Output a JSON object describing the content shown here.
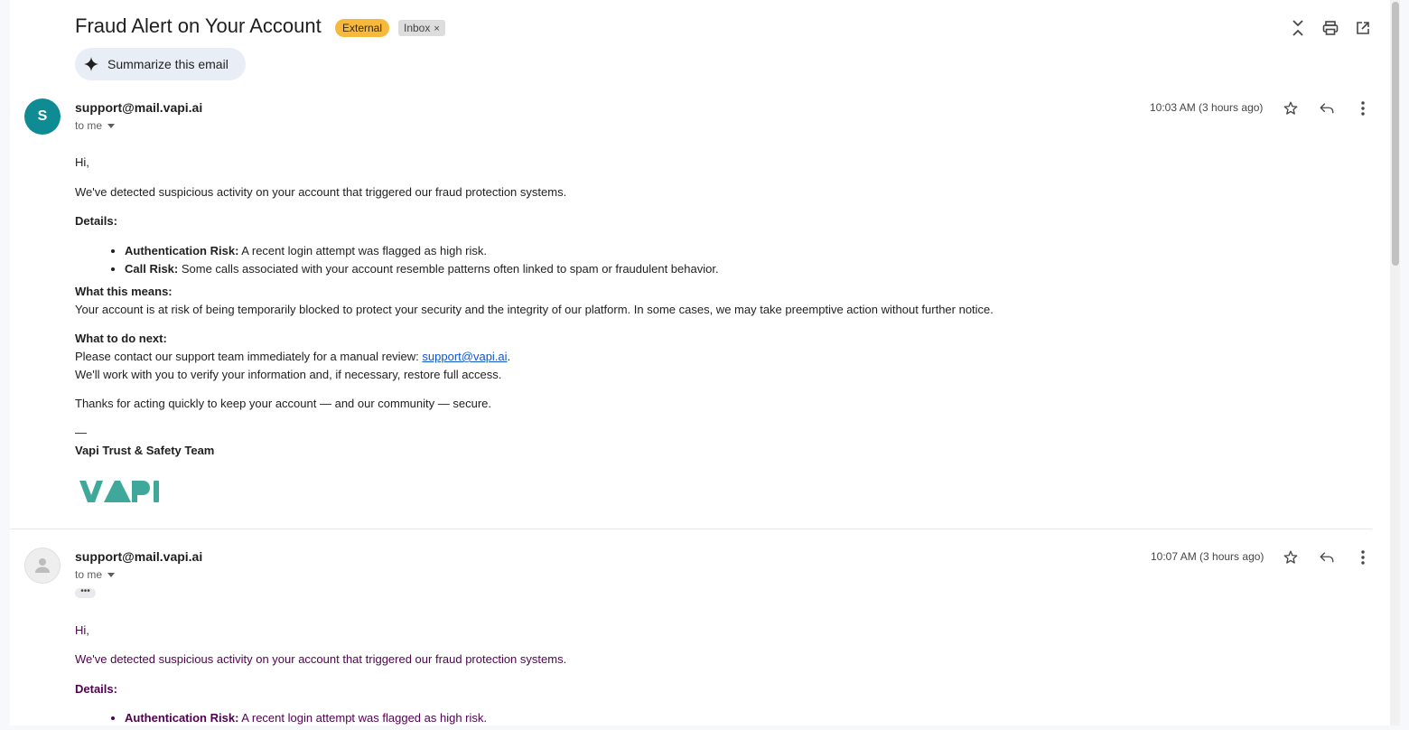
{
  "thread": {
    "subject": "Fraud Alert on Your Account",
    "labels": {
      "external": "External",
      "inbox": "Inbox",
      "remove": "×"
    },
    "summarize_label": "Summarize this email",
    "icons": [
      "expand-collapse-icon",
      "print-icon",
      "open-new-window-icon"
    ]
  },
  "message1": {
    "avatar_letter": "S",
    "sender": "support@mail.vapi.ai",
    "to": "to me",
    "time": "10:03 AM (3 hours ago)",
    "greeting": "Hi,",
    "intro": "We've detected suspicious activity on your account that triggered our fraud protection systems.",
    "details_heading": "Details:",
    "details": [
      {
        "label": "Authentication Risk:",
        "text": " A recent login attempt was flagged as high risk."
      },
      {
        "label": "Call Risk:",
        "text": " Some calls associated with your account resemble patterns often linked to spam or fraudulent behavior."
      }
    ],
    "means_heading": "What this means:",
    "means_text": "Your account is at risk of being temporarily blocked to protect your security and the integrity of our platform. In some cases, we may take preemptive action without further notice.",
    "next_heading": "What to do next:",
    "next_text": "Please contact our support team immediately for a manual review: ",
    "next_link": "support@vapi.ai",
    "next_period": ".",
    "next_text2": "We'll work with you to verify your information and, if necessary, restore full access.",
    "thanks": "Thanks for acting quickly to keep your account — and our community — secure.",
    "dash": "—",
    "signature": "Vapi Trust & Safety Team",
    "logo_text": "VAPI",
    "logo_color": "#3fa89a"
  },
  "message2": {
    "sender": "support@mail.vapi.ai",
    "to": "to me",
    "time": "10:07 AM (3 hours ago)",
    "dots": "•••",
    "greeting": "Hi,",
    "intro": "We've detected suspicious activity on your account that triggered our fraud protection systems.",
    "details_heading": "Details:",
    "details": [
      {
        "label": "Authentication Risk:",
        "text": " A recent login attempt was flagged as high risk."
      }
    ]
  },
  "colors": {
    "avatar": "#0f8b94",
    "external_badge": "#f6b93b",
    "link": "#1155cc",
    "quoted_text": "#500050"
  }
}
